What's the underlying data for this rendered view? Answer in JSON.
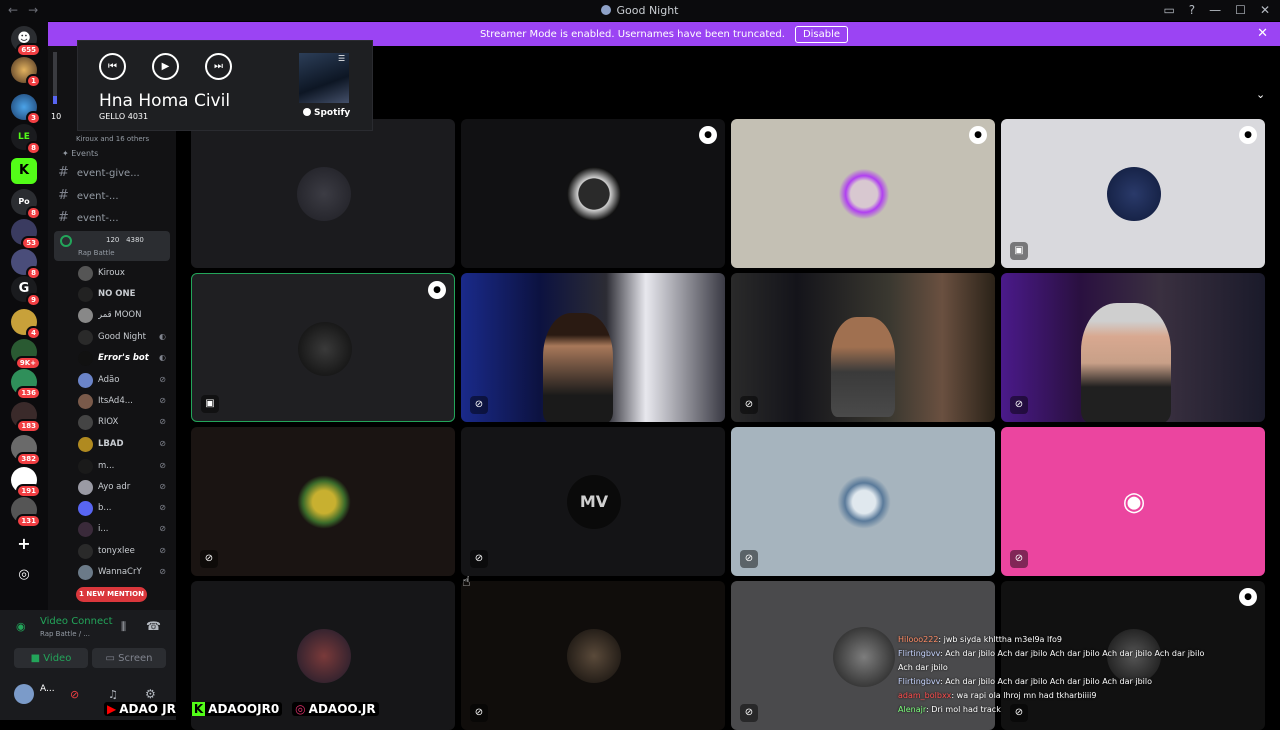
{
  "window": {
    "title": "Good Night",
    "controls": [
      "▭",
      "?",
      "—",
      "☐",
      "✕"
    ]
  },
  "banner": {
    "text": "Streamer Mode is enabled. Usernames have been truncated.",
    "button": "Disable"
  },
  "servers": {
    "badges": [
      "655",
      "1",
      "3",
      "8",
      "8",
      "53",
      "8",
      "9",
      "4",
      "9K+",
      "136",
      "183",
      "382",
      "191",
      "131"
    ]
  },
  "media": {
    "track": "Hna Homa Civil",
    "artist": "GELLO 4031",
    "provider": "Spotify",
    "volume_label": "10",
    "volume_level": 0.15
  },
  "sidebar": {
    "stage_hint": "Kiroux and 16 others",
    "events_label": "Events",
    "channels": [
      "event-give...",
      "event-...",
      "event-..."
    ],
    "voice_channel": {
      "name": "Rap Battle",
      "count": "120",
      "limit": "4380"
    },
    "members": [
      "Kiroux",
      "NO ONE",
      "قمر MOON",
      "Good Night",
      "Error's bot",
      "Adão",
      "ItsAd4...",
      "RIOX",
      "LBAD",
      "m...",
      "Ayo adr",
      "b...",
      "i...",
      "tonyxlee",
      "WannaCrY"
    ],
    "new_mention": "1 NEW MENTION"
  },
  "voice": {
    "status": "Video Connect",
    "channel": "Rap Battle / ...",
    "video_btn": "Video",
    "screen_btn": "Screen",
    "user": "A..."
  },
  "chat": [
    {
      "user": "Hilooo222",
      "msg": ": jwb siyda khlttha m3el9a lfo9"
    },
    {
      "user": "Flirtingbvv",
      "msg": ": Ach dar jbilo Ach dar jbilo Ach dar jbilo Ach dar jbilo Ach dar jbilo Ach dar jbilo"
    },
    {
      "user": "Flirtingbvv",
      "msg": ": Ach dar jbilo Ach dar jbilo Ach dar jbilo Ach dar jbilo"
    },
    {
      "user": "adam_bolbxx",
      "msg": ": wa rapi ola lhroj mn had tkharbiiii9"
    },
    {
      "user": "Alenajr",
      "msg": ": Dri mol had track"
    }
  ],
  "socials": [
    "ADAO JR",
    "ADAOOJR0",
    "ADAOO.JR"
  ],
  "colors": {
    "accent": "#9b44f3",
    "speaking": "#23a55a",
    "discord": "#5865f2",
    "mention": "#da373c"
  }
}
